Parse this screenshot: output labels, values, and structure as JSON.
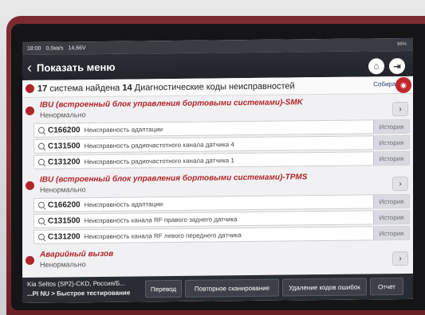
{
  "status_bar": {
    "time": "18:00",
    "network": "0,0кв/s",
    "voltage": "14,66V",
    "battery": "96%"
  },
  "header": {
    "title": "Показать меню",
    "back_icon": "chevron-left-icon",
    "home_icon": "home-icon",
    "exit_icon": "exit-icon"
  },
  "summary": {
    "systems_count": "17",
    "systems_text": "система найдена",
    "dtc_count": "14",
    "dtc_text": "Диагностические коды неисправностей",
    "collect_label": "Собирать",
    "camera_icon": "camera-icon"
  },
  "systems": [
    {
      "name": "IBU (встроенный блок управления бортовыми системами)-SMK",
      "status": "Ненормально",
      "codes": [
        {
          "code": "C166200",
          "desc": "Неисправность адаптации",
          "history": "История"
        },
        {
          "code": "C131500",
          "desc": "Неисправность радиочастотного канала датчика 4",
          "history": "История"
        },
        {
          "code": "C131200",
          "desc": "Неисправность радиочастотного канала датчика 1",
          "history": "История"
        }
      ]
    },
    {
      "name": "IBU (встроенный блок управления бортовыми системами)-TPMS",
      "status": "Ненормально",
      "codes": [
        {
          "code": "C166200",
          "desc": "Неисправность адаптации",
          "history": "История"
        },
        {
          "code": "C131500",
          "desc": "Неисправность канала RF правого заднего датчика",
          "history": "История"
        },
        {
          "code": "C131200",
          "desc": "Неисправность канала RF левого переднего датчика",
          "history": "История"
        }
      ]
    },
    {
      "name": "Аварийный вызов",
      "status": "Ненормально",
      "codes": []
    }
  ],
  "footer": {
    "vehicle_line1": "Kia  Seltos (SP2)-CKD, Россия/Б...",
    "vehicle_line2": "...PI NU > Быстрое тестирование",
    "translate_button": "Перевод",
    "rescan_button": "Повторное сканирование",
    "clear_codes_button": "Удаление кодов ошибок",
    "report_button": "Отчет"
  }
}
